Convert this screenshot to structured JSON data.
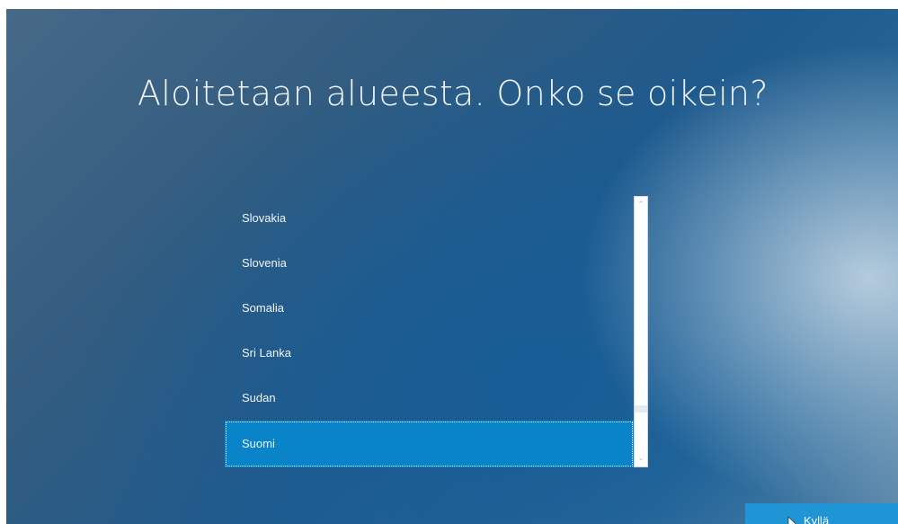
{
  "setup": {
    "title": "Aloitetaan alueesta. Onko se oikein?",
    "regions": [
      {
        "label": "Slovakia",
        "selected": false
      },
      {
        "label": "Slovenia",
        "selected": false
      },
      {
        "label": "Somalia",
        "selected": false
      },
      {
        "label": "Sri Lanka",
        "selected": false
      },
      {
        "label": "Sudan",
        "selected": false
      },
      {
        "label": "Suomi",
        "selected": true
      }
    ],
    "scroll_up_icon": "chevron-up-icon",
    "scroll_down_icon": "chevron-down-icon",
    "confirm_label": "Kyllä",
    "colors": {
      "accent": "#1f95d6",
      "selected": "#0a84c9",
      "text": "#f2f6fa"
    }
  }
}
